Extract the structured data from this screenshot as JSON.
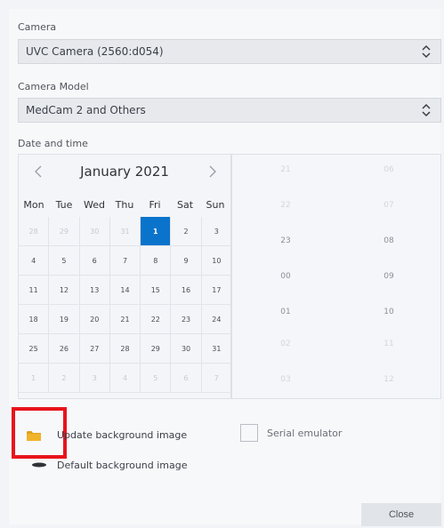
{
  "camera": {
    "label": "Camera",
    "value": "UVC Camera (2560:d054)"
  },
  "camera_model": {
    "label": "Camera Model",
    "value": "MedCam 2 and Others"
  },
  "datetime": {
    "label": "Date and time",
    "calendar": {
      "month": "January 2021",
      "weekdays": [
        "Mon",
        "Tue",
        "Wed",
        "Thu",
        "Fri",
        "Sat",
        "Sun"
      ],
      "days": [
        {
          "d": "28",
          "muted": true
        },
        {
          "d": "29",
          "muted": true
        },
        {
          "d": "30",
          "muted": true
        },
        {
          "d": "31",
          "muted": true
        },
        {
          "d": "1",
          "selected": true
        },
        {
          "d": "2"
        },
        {
          "d": "3"
        },
        {
          "d": "4"
        },
        {
          "d": "5"
        },
        {
          "d": "6"
        },
        {
          "d": "7"
        },
        {
          "d": "8"
        },
        {
          "d": "9"
        },
        {
          "d": "10"
        },
        {
          "d": "11"
        },
        {
          "d": "12"
        },
        {
          "d": "13"
        },
        {
          "d": "14"
        },
        {
          "d": "15"
        },
        {
          "d": "16"
        },
        {
          "d": "17"
        },
        {
          "d": "18"
        },
        {
          "d": "19"
        },
        {
          "d": "20"
        },
        {
          "d": "21"
        },
        {
          "d": "22"
        },
        {
          "d": "23"
        },
        {
          "d": "24"
        },
        {
          "d": "25"
        },
        {
          "d": "26"
        },
        {
          "d": "27"
        },
        {
          "d": "28"
        },
        {
          "d": "29"
        },
        {
          "d": "30"
        },
        {
          "d": "31"
        },
        {
          "d": "1",
          "muted": true
        },
        {
          "d": "2",
          "muted": true
        },
        {
          "d": "3",
          "muted": true
        },
        {
          "d": "4",
          "muted": true
        },
        {
          "d": "5",
          "muted": true
        },
        {
          "d": "6",
          "muted": true
        },
        {
          "d": "7",
          "muted": true
        }
      ]
    },
    "hours": [
      {
        "v": "21",
        "faint": true
      },
      {
        "v": "22",
        "faint": true
      },
      {
        "v": "23"
      },
      {
        "v": "00"
      },
      {
        "v": "01"
      },
      {
        "v": "02",
        "faint": true
      },
      {
        "v": "03",
        "faint": true
      }
    ],
    "minutes": [
      {
        "v": "06",
        "faint": true
      },
      {
        "v": "07",
        "faint": true
      },
      {
        "v": "08"
      },
      {
        "v": "09"
      },
      {
        "v": "10"
      },
      {
        "v": "11",
        "faint": true
      },
      {
        "v": "12",
        "faint": true
      }
    ]
  },
  "options": {
    "update_bg": "Update background image",
    "default_bg": "Default background image",
    "serial_emulator": "Serial emulator"
  },
  "close_label": "Close",
  "colors": {
    "accent": "#0a74cc",
    "highlight": "#e8131c",
    "folder": "#e0a21a"
  }
}
